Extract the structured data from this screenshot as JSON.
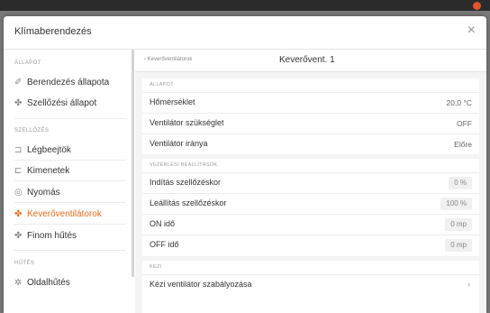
{
  "window": {
    "title": ""
  },
  "dialog": {
    "title": "Klímaberendezés",
    "close_icon": "close-icon"
  },
  "sidebar": {
    "sections": [
      {
        "label": "ÁLLAPOT"
      },
      {
        "label": "SZELLŐZÉS"
      },
      {
        "label": "HŰTÉS"
      }
    ],
    "items": [
      {
        "label": "Berendezés állapota",
        "icon": "leaf-icon",
        "glyph": "✐"
      },
      {
        "label": "Szellőzési állapot",
        "icon": "fan-icon",
        "glyph": "✤"
      },
      {
        "label": "Légbeejtök",
        "icon": "air-inlet-icon",
        "glyph": "⊐"
      },
      {
        "label": "Kimenetek",
        "icon": "outlet-icon",
        "glyph": "⊏"
      },
      {
        "label": "Nyomás",
        "icon": "pressure-gauge-icon",
        "glyph": "◎"
      },
      {
        "label": "Keverőventilátorok",
        "icon": "mixing-fan-icon",
        "glyph": "✤",
        "active": true
      },
      {
        "label": "Finom hűtés",
        "icon": "fine-cooling-icon",
        "glyph": "✤"
      },
      {
        "label": "Oldalhűtés",
        "icon": "side-cooling-icon",
        "glyph": "✲"
      }
    ]
  },
  "main": {
    "back_label": "‹  Keverőventilátorok",
    "title": "Keverővent. 1",
    "sections": [
      {
        "label": "ÁLLAPOT",
        "rows": [
          {
            "label": "Hőmérséklet",
            "value": "20,0 °C"
          },
          {
            "label": "Ventilátor szükséglet",
            "value": "OFF"
          },
          {
            "label": "Ventilátor iránya",
            "value": "Előre"
          }
        ]
      },
      {
        "label": "VEZÉRLÉSI BEÁLLÍTÁSOK",
        "rows": [
          {
            "label": "Indítás szellőzéskor",
            "value": "0 %"
          },
          {
            "label": "Leállítás szellőzéskor",
            "value": "100 %"
          },
          {
            "label": "ON idő",
            "value": "0 mp"
          },
          {
            "label": "OFF idő",
            "value": "0 mp"
          }
        ]
      },
      {
        "label": "KÉZI",
        "rows": [
          {
            "label": "Kézi ventilátor szabályozása",
            "value": "›"
          }
        ]
      }
    ]
  },
  "colors": {
    "accent": "#e06a1e",
    "close_dot": "#e0552e"
  }
}
